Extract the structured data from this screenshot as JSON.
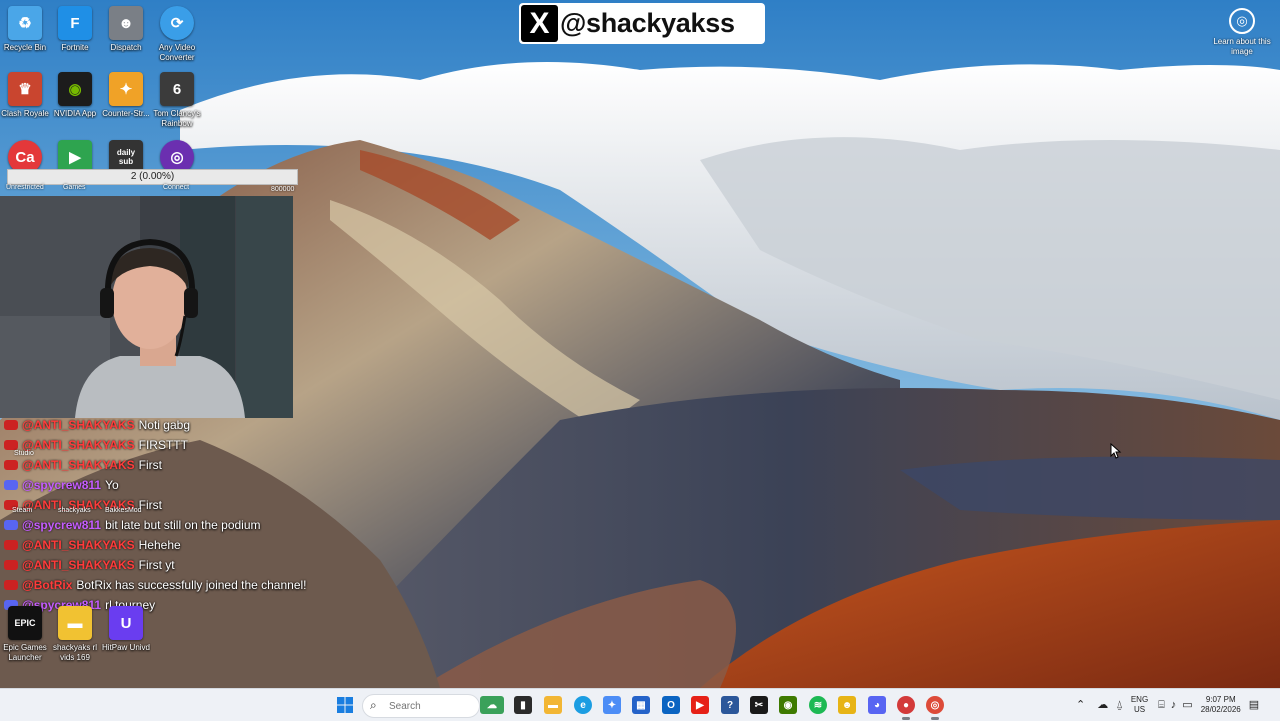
{
  "banner": {
    "logo": "X",
    "handle": "@shackyakss"
  },
  "learn_about": {
    "icon": "camera-icon",
    "label": "Learn about this image"
  },
  "desktop_icons": {
    "recycle_bin": {
      "label": "Recycle Bin",
      "color": "#4aa6e8"
    },
    "fortnite": {
      "label": "Fortnite",
      "glyph": "F",
      "color": "#1f8fe6"
    },
    "dispatch": {
      "label": "Dispatch",
      "color": "#7a7f86"
    },
    "any_video": {
      "label": "Any Video Converter",
      "color": "#3a9ee8"
    },
    "clash_royale": {
      "label": "Clash Royale",
      "color": "#c9452f"
    },
    "nvidia_app": {
      "label": "NVIDIA App",
      "color": "#76b900"
    },
    "counter_strike": {
      "label": "Counter-Str...",
      "color": "#f0a227"
    },
    "rainbow_six": {
      "label": "Tom Clancy's Rainbow Six...",
      "glyph": "6",
      "color": "#3b3b3b"
    },
    "canva": {
      "label": "Unrestricted",
      "glyph": "Ca",
      "color": "#e4383a"
    },
    "games": {
      "label": "Games",
      "color": "#2ea44f"
    },
    "daily_sub": {
      "label": "daily sub",
      "color": "#333333"
    },
    "connect": {
      "label": "Connect",
      "color": "#6b2fb0"
    },
    "steam": {
      "label": "Steam"
    },
    "shackyaks_bakkes": {
      "label": "shackyaks"
    },
    "bakkesmod": {
      "label": "BakkesMod"
    },
    "studio": {
      "label": "Studio"
    },
    "epic": {
      "label": "Epic Games Launcher",
      "glyph": "EPIC",
      "color": "#111111"
    },
    "shackyaks_rl": {
      "label": "shackyaks rl vids 169",
      "color": "#f1c232"
    },
    "hitpaw": {
      "label": "HitPaw Univd",
      "color": "#6a3df0"
    }
  },
  "progress": {
    "text": "2 (0.00%)",
    "value": 0.0,
    "goal_label": "800000"
  },
  "chat": [
    {
      "user": "@ANTI_SHAKYAKS",
      "msg": "Noti gabg",
      "user_color": "#ff3b3b",
      "badge": "#cc2222"
    },
    {
      "user": "@ANTI_SHAKYAKS",
      "msg": "FIRSTTT",
      "user_color": "#ff3b3b",
      "badge": "#cc2222"
    },
    {
      "user": "@ANTI_SHAKYAKS",
      "msg": "First",
      "user_color": "#ff3b3b",
      "badge": "#cc2222"
    },
    {
      "user": "@spycrew811",
      "msg": "Yo",
      "user_color": "#c45cff",
      "badge": "#5865f2"
    },
    {
      "user": "@ANTI_SHAKYAKS",
      "msg": "First",
      "user_color": "#ff3b3b",
      "badge": "#cc2222"
    },
    {
      "user": "@spycrew811",
      "msg": "bit late but still on the podium",
      "user_color": "#c45cff",
      "badge": "#5865f2"
    },
    {
      "user": "@ANTI_SHAKYAKS",
      "msg": "Hehehe",
      "user_color": "#ff3b3b",
      "badge": "#cc2222"
    },
    {
      "user": "@ANTI_SHAKYAKS",
      "msg": "First yt",
      "user_color": "#ff3b3b",
      "badge": "#cc2222"
    },
    {
      "user": "@BotRix",
      "msg": "BotRix has successfully joined the channel!",
      "user_color": "#ff3b3b",
      "badge": "#cc2222"
    },
    {
      "user": "@spycrew811",
      "msg": "rl tourney",
      "user_color": "#c45cff",
      "badge": "#5865f2"
    }
  ],
  "taskbar": {
    "start": {
      "icon": "windows-start-icon"
    },
    "search": {
      "placeholder": "Search",
      "icon": "search-icon"
    },
    "apps": [
      {
        "name": "widgets-icon",
        "color": "#3aa15a"
      },
      {
        "name": "task-view-icon",
        "color": "#2b2b2b"
      },
      {
        "name": "file-explorer-icon",
        "color": "#f2b634"
      },
      {
        "name": "edge-icon",
        "color": "#1b9de2"
      },
      {
        "name": "copilot-icon",
        "color": "#4c8df6"
      },
      {
        "name": "store-icon",
        "color": "#2563c9"
      },
      {
        "name": "outlook-icon",
        "color": "#0a64c2"
      },
      {
        "name": "youtube-icon",
        "color": "#e62117"
      },
      {
        "name": "app-icon",
        "color": "#2b579a"
      },
      {
        "name": "capcut-icon",
        "color": "#1a1a1a"
      },
      {
        "name": "nvidia-icon",
        "color": "#3e7a00"
      },
      {
        "name": "spotify-icon",
        "color": "#1db954"
      },
      {
        "name": "game-icon",
        "color": "#e7b416"
      },
      {
        "name": "discord-icon",
        "color": "#5865f2"
      },
      {
        "name": "obs-icon",
        "color": "#d33a3a"
      },
      {
        "name": "chrome-icon",
        "color": "#dd4b39"
      }
    ],
    "tray": {
      "language": "ENG",
      "region": "US",
      "time": "9:07 PM",
      "date": "28/02/2026"
    }
  }
}
